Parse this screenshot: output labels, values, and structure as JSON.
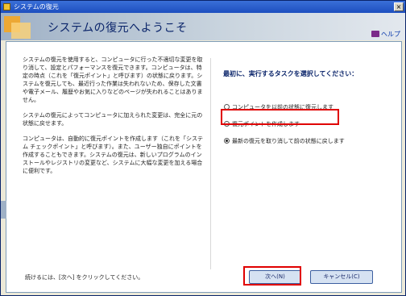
{
  "window": {
    "title": "システムの復元",
    "close_label": "×"
  },
  "header": {
    "title": "システムの復元へようこそ",
    "help_label": "ヘルプ"
  },
  "left": {
    "paragraphs": [
      "システムの復元を使用すると、コンピュータに行った不適切な変更を取り消して、設定とパフォーマンスを復元できます。コンピュータは、特定の時点（これを「復元ポイント」と呼びます）の状態に戻ります。システムを復元しても、最近行った作業は失われないため、保存した文書や電子メール、履歴やお気に入りなどのページが失われることはありません。",
      "システムの復元によってコンピュータに加えられた変更は、完全に元の状態に戻せます。",
      "コンピュータは、自動的に復元ポイントを作成します（これを「システム チェックポイント」と呼びます）。また、ユーザー独自にポイントを作成することもできます。システムの復元は、新しいプログラムのインストールやレジストリの変更など、システムに大幅な変更を加える場合に便利です。"
    ],
    "footer": "続けるには、[次へ] をクリックしてください。"
  },
  "right": {
    "title": "最初に、実行するタスクを選択してください：",
    "options": [
      {
        "label": "コンピュータを以前の状態に復元します",
        "selected": false
      },
      {
        "label": "復元ポイントを作成します",
        "selected": false
      },
      {
        "label": "最新の復元を取り消して前の状態に戻します",
        "selected": true
      }
    ]
  },
  "buttons": {
    "next_label": "次へ(N)",
    "cancel_label": "キャンセル(C)"
  },
  "colors": {
    "accent": "#0a246a",
    "highlight": "#e00000"
  }
}
